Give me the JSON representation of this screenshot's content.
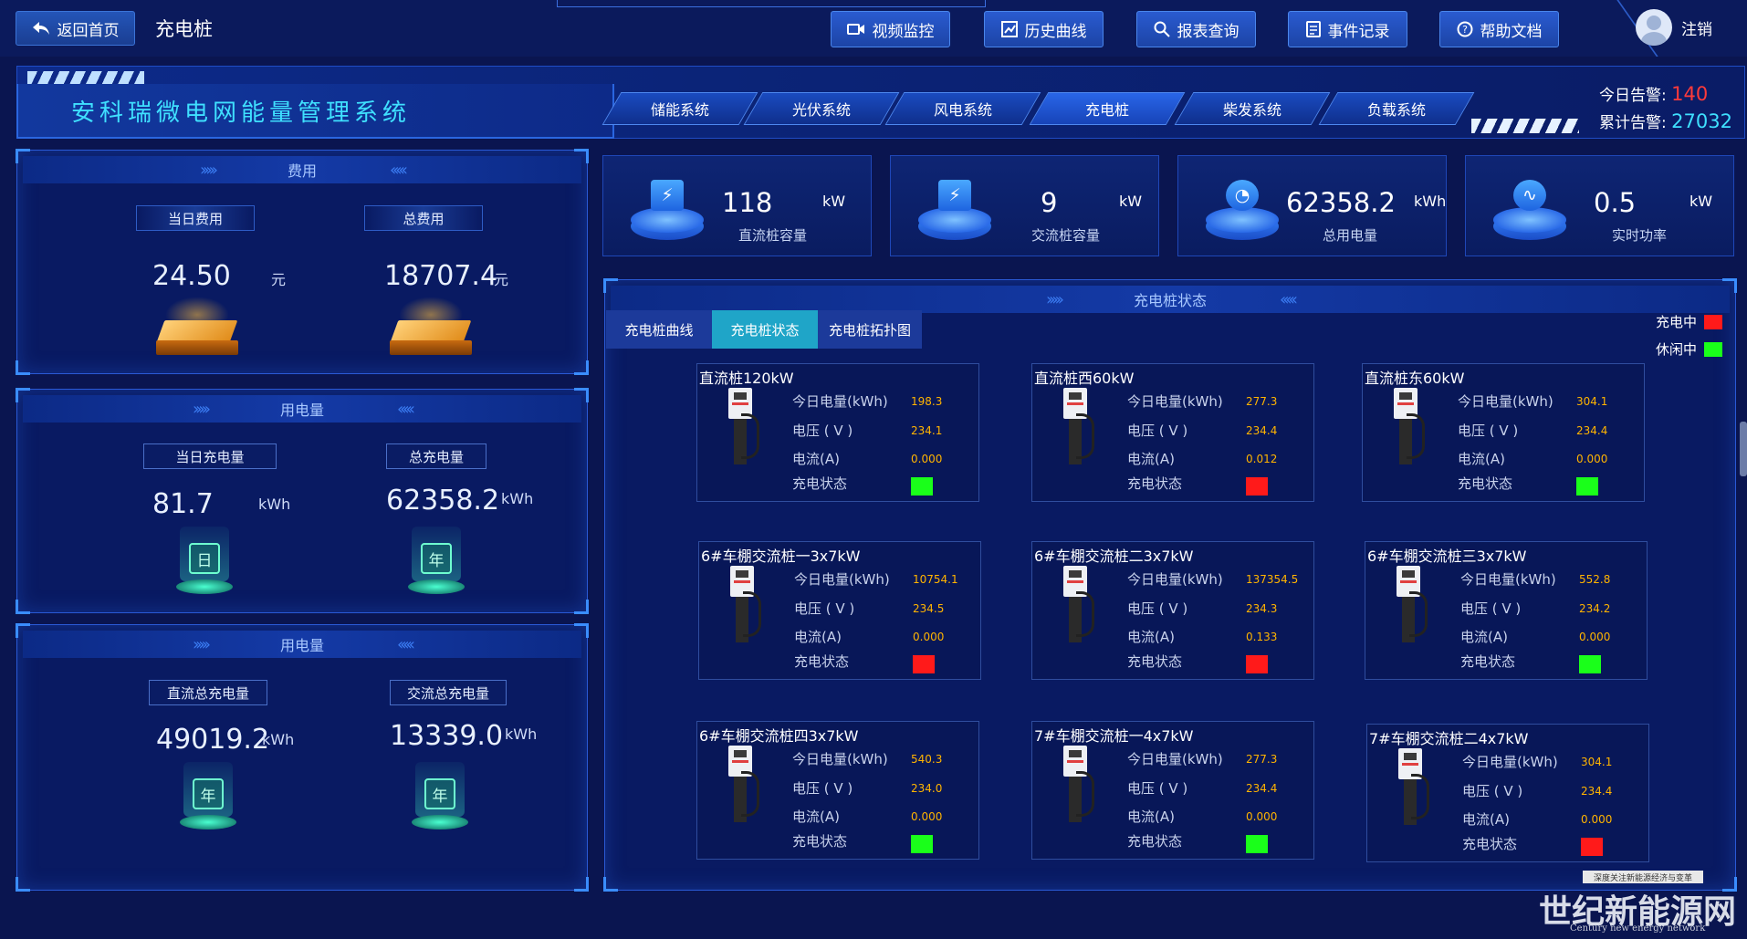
{
  "topbar": {
    "back_label": "返回首页",
    "page_name": "充电桩",
    "buttons": [
      "视频监控",
      "历史曲线",
      "报表查询",
      "事件记录",
      "帮助文档"
    ],
    "logout_label": "注销"
  },
  "header": {
    "system_title": "安科瑞微电网能量管理系统",
    "nav_tabs": [
      "储能系统",
      "光伏系统",
      "风电系统",
      "充电桩",
      "柴发系统",
      "负载系统"
    ],
    "active_tab": "充电桩",
    "alarm_today_label": "今日告警:",
    "alarm_today_value": "140",
    "alarm_total_label": "累计告警:",
    "alarm_total_value": "27032"
  },
  "cost_panel": {
    "title": "费用",
    "today_label": "当日费用",
    "today_value": "24.50",
    "today_unit": "元",
    "total_label": "总费用",
    "total_value": "18707.4",
    "total_unit": "元"
  },
  "usage_panel": {
    "title": "用电量",
    "today_label": "当日充电量",
    "today_value": "81.7",
    "today_unit": "kWh",
    "today_icon": "日",
    "total_label": "总充电量",
    "total_value": "62358.2",
    "total_unit": "kWh",
    "total_icon": "年"
  },
  "split_panel": {
    "title": "用电量",
    "dc_label": "直流总充电量",
    "dc_value": "49019.2",
    "dc_unit": "kWh",
    "dc_icon": "年",
    "ac_label": "交流总充电量",
    "ac_value": "13339.0",
    "ac_unit": "kWh",
    "ac_icon": "年"
  },
  "stats": [
    {
      "value": "118",
      "unit": "kW",
      "label": "直流桩容量",
      "icon": "lightning-icon"
    },
    {
      "value": "9",
      "unit": "kW",
      "label": "交流桩容量",
      "icon": "lightning-icon"
    },
    {
      "value": "62358.2",
      "unit": "kWh",
      "label": "总用电量",
      "icon": "gauge-icon"
    },
    {
      "value": "0.5",
      "unit": "kW",
      "label": "实时功率",
      "icon": "pulse-icon"
    }
  ],
  "status_panel": {
    "title": "充电桩状态",
    "sub_tabs": [
      "充电桩曲线",
      "充电桩状态",
      "充电桩拓扑图"
    ],
    "active_sub_tab": "充电桩状态",
    "legend": [
      {
        "label": "充电中",
        "color": "#ff1a1a"
      },
      {
        "label": "休闲中",
        "color": "#1aff1a"
      }
    ],
    "row_labels": {
      "energy": "今日电量(kWh)",
      "voltage": "电压 ( V )",
      "current": "电流(A)",
      "status": "充电状态"
    },
    "piles": [
      {
        "name": "直流桩120kW",
        "energy": "198.3",
        "voltage": "234.1",
        "current": "0.000",
        "status_color": "#1aff1a"
      },
      {
        "name": "直流桩西60kW",
        "energy": "277.3",
        "voltage": "234.4",
        "current": "0.012",
        "status_color": "#ff1a1a"
      },
      {
        "name": "直流桩东60kW",
        "energy": "304.1",
        "voltage": "234.4",
        "current": "0.000",
        "status_color": "#1aff1a"
      },
      {
        "name": "6#车棚交流桩一3x7kW",
        "energy": "10754.1",
        "voltage": "234.5",
        "current": "0.000",
        "status_color": "#ff1a1a"
      },
      {
        "name": "6#车棚交流桩二3x7kW",
        "energy": "137354.5",
        "voltage": "234.3",
        "current": "0.133",
        "status_color": "#ff1a1a"
      },
      {
        "name": "6#车棚交流桩三3x7kW",
        "energy": "552.8",
        "voltage": "234.2",
        "current": "0.000",
        "status_color": "#1aff1a"
      },
      {
        "name": "6#车棚交流桩四3x7kW",
        "energy": "540.3",
        "voltage": "234.0",
        "current": "0.000",
        "status_color": "#1aff1a"
      },
      {
        "name": "7#车棚交流桩一4x7kW",
        "energy": "277.3",
        "voltage": "234.4",
        "current": "0.000",
        "status_color": "#1aff1a"
      },
      {
        "name": "7#车棚交流桩二4x7kW",
        "energy": "304.1",
        "voltage": "234.4",
        "current": "0.000",
        "status_color": "#ff1a1a"
      }
    ]
  },
  "watermark": {
    "tagline": "深度关注新能源经济与变革",
    "name": "世纪新能源网",
    "english": "Century new energy network"
  }
}
